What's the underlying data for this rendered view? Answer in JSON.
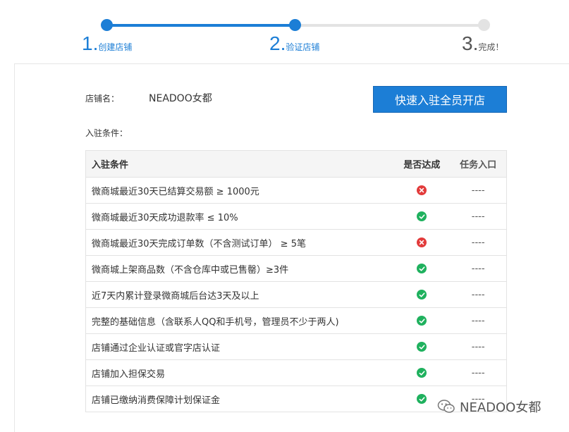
{
  "steps": [
    {
      "number": "1.",
      "label": "创建店铺"
    },
    {
      "number": "2.",
      "label": "验证店铺"
    },
    {
      "number": "3.",
      "label": "完成！"
    }
  ],
  "shop": {
    "label": "店铺名：",
    "name": "NEADOO女都"
  },
  "open_button": "快速入驻全员开店",
  "conditions_label": "入驻条件：",
  "table": {
    "headers": [
      "入驻条件",
      "是否达成",
      "任务入口"
    ],
    "rows": [
      {
        "condition": "微商城最近30天已结算交易额 ≥ 1000元",
        "status": "fail",
        "entry": "----"
      },
      {
        "condition": "微商城最近30天成功退款率 ≤ 10%",
        "status": "ok",
        "entry": "----"
      },
      {
        "condition": "微商城最近30天完成订单数（不含测试订单） ≥ 5笔",
        "status": "fail",
        "entry": "----"
      },
      {
        "condition": "微商城上架商品数（不含仓库中或已售罄）≥3件",
        "status": "ok",
        "entry": "----"
      },
      {
        "condition": "近7天内累计登录微商城后台达3天及以上",
        "status": "ok",
        "entry": "----"
      },
      {
        "condition": "完整的基础信息（含联系人QQ和手机号，管理员不少于两人)",
        "status": "ok",
        "entry": "----"
      },
      {
        "condition": "店铺通过企业认证或官字店认证",
        "status": "ok",
        "entry": "----"
      },
      {
        "condition": "店铺加入担保交易",
        "status": "ok",
        "entry": "----"
      },
      {
        "condition": "店铺已缴纳消费保障计划保证金",
        "status": "ok",
        "entry": "----"
      }
    ]
  },
  "watermark": "NEADOO女都",
  "colors": {
    "accent": "#1c7ed6",
    "ok": "#1fb15e",
    "fail": "#e23b3b"
  }
}
